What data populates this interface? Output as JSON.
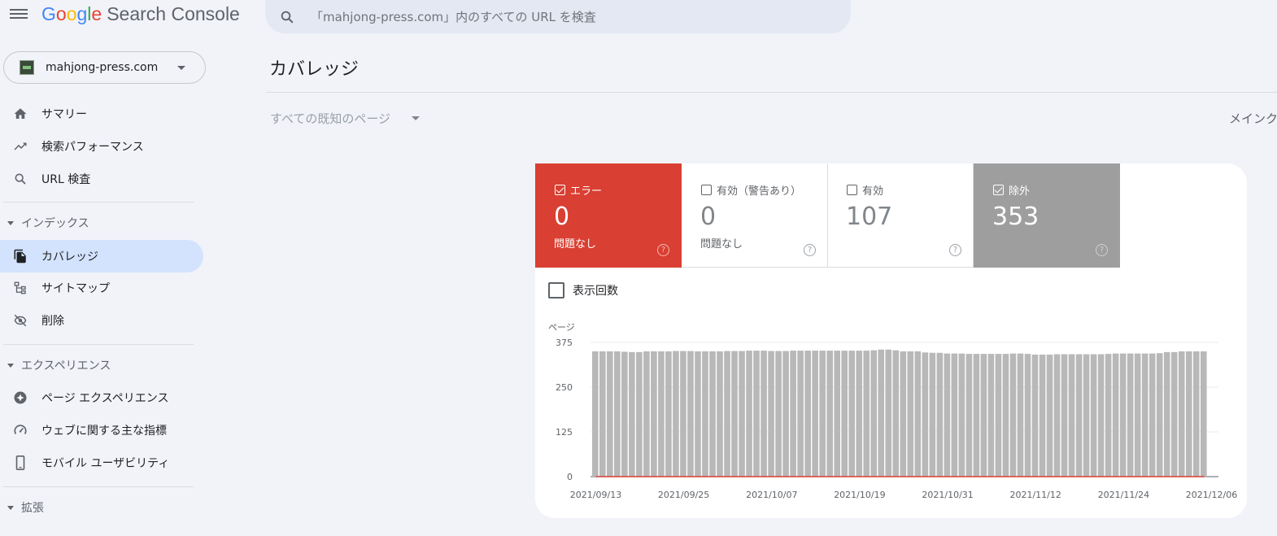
{
  "header": {
    "logo_google": [
      "G",
      "o",
      "o",
      "g",
      "l",
      "e"
    ],
    "logo_product": "Search Console",
    "search_placeholder": "「mahjong-press.com」内のすべての URL を検査"
  },
  "property": {
    "name": "mahjong-press.com"
  },
  "sidebar": {
    "items": [
      {
        "label": "サマリー",
        "icon": "home-icon"
      },
      {
        "label": "検索パフォーマンス",
        "icon": "trending-up-icon"
      },
      {
        "label": "URL 検査",
        "icon": "search-icon"
      }
    ],
    "sections": [
      {
        "label": "インデックス",
        "items": [
          {
            "label": "カバレッジ",
            "icon": "file-copy-icon",
            "active": true
          },
          {
            "label": "サイトマップ",
            "icon": "sitemap-icon"
          },
          {
            "label": "削除",
            "icon": "visibility-off-icon"
          }
        ]
      },
      {
        "label": "エクスペリエンス",
        "items": [
          {
            "label": "ページ エクスペリエンス",
            "icon": "star-badge-icon"
          },
          {
            "label": "ウェブに関する主な指標",
            "icon": "speed-gauge-icon"
          },
          {
            "label": "モバイル ユーザビリティ",
            "icon": "smartphone-icon"
          }
        ]
      },
      {
        "label": "拡張",
        "items": []
      }
    ]
  },
  "main": {
    "title": "カバレッジ",
    "filter_label": "すべての既知のページ",
    "crawler_label": "メインク"
  },
  "tiles": [
    {
      "label": "エラー",
      "value": "0",
      "sub": "問題なし",
      "checked": true,
      "color": "#d93f32"
    },
    {
      "label": "有効（警告あり）",
      "value": "0",
      "sub": "問題なし",
      "checked": false,
      "color": "#ffffff"
    },
    {
      "label": "有効",
      "value": "107",
      "sub": "",
      "checked": false,
      "color": "#ffffff"
    },
    {
      "label": "除外",
      "value": "353",
      "sub": "",
      "checked": true,
      "color": "#9e9e9e"
    }
  ],
  "help_glyph": "?",
  "impressions_label": "表示回数",
  "chart_data": {
    "type": "bar",
    "ylabel": "ページ",
    "ylim": [
      0,
      375
    ],
    "yticks": [
      "0",
      "125",
      "250",
      "375"
    ],
    "xtick_labels": [
      "2021/09/13",
      "2021/09/25",
      "2021/10/07",
      "2021/10/19",
      "2021/10/31",
      "2021/11/12",
      "2021/11/24",
      "2021/12/06"
    ],
    "series": [
      {
        "name": "除外",
        "color": "#b8b8b8",
        "values": [
          350,
          350,
          350,
          350,
          349,
          348,
          348,
          350,
          350,
          350,
          350,
          351,
          351,
          351,
          350,
          350,
          350,
          350,
          351,
          351,
          351,
          352,
          352,
          352,
          351,
          351,
          351,
          352,
          352,
          352,
          352,
          352,
          352,
          352,
          352,
          352,
          352,
          352,
          353,
          355,
          355,
          353,
          350,
          350,
          350,
          347,
          346,
          346,
          344,
          344,
          344,
          343,
          343,
          343,
          343,
          343,
          343,
          344,
          344,
          343,
          341,
          341,
          341,
          342,
          342,
          342,
          342,
          342,
          342,
          342,
          343,
          344,
          344,
          344,
          344,
          344,
          344,
          345,
          348,
          348,
          350,
          350,
          350,
          350
        ]
      },
      {
        "name": "エラー",
        "color": "#d93f32",
        "values": [
          0,
          0,
          0,
          0,
          0,
          0,
          0,
          0,
          0,
          0,
          0,
          0,
          0,
          0,
          0,
          0,
          0,
          0,
          0,
          0,
          0,
          0,
          0,
          0,
          0,
          0,
          0,
          0,
          0,
          0,
          0,
          0,
          0,
          0,
          0,
          0,
          0,
          0,
          0,
          0,
          0,
          0,
          0,
          0,
          0,
          0,
          0,
          0,
          0,
          0,
          0,
          0,
          0,
          0,
          0,
          0,
          0,
          0,
          0,
          0,
          0,
          0,
          0,
          0,
          0,
          0,
          0,
          0,
          0,
          0,
          0,
          0,
          0,
          0,
          0,
          0,
          0,
          0,
          0,
          0,
          0,
          0,
          0,
          0
        ]
      }
    ],
    "grid": true
  }
}
